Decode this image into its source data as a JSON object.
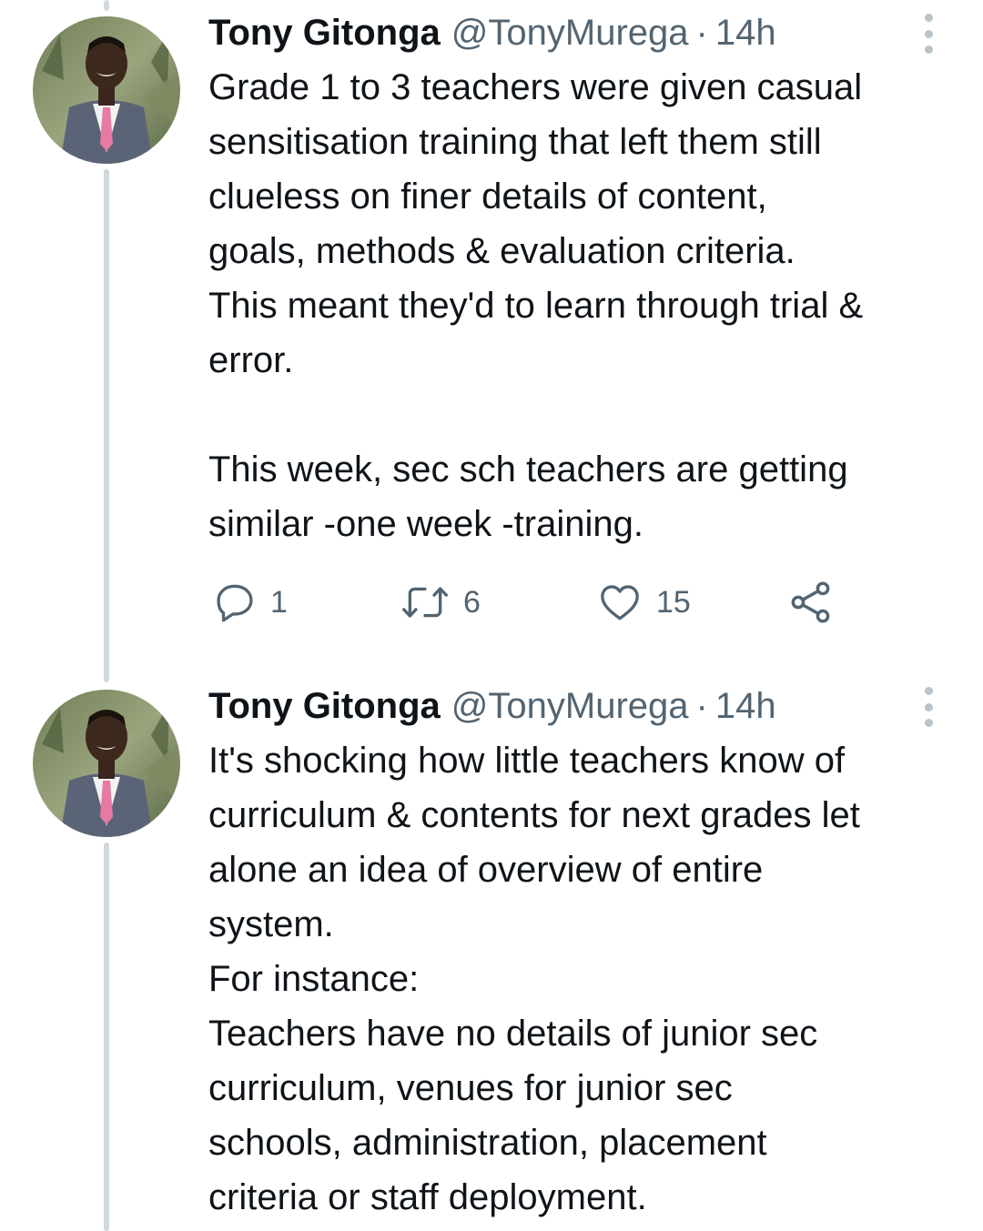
{
  "tweets": [
    {
      "author_name": "Tony Gitonga",
      "author_handle": "@TonyMurega",
      "separator": "·",
      "timestamp": "14h",
      "lines": [
        "Grade 1 to 3 teachers were given casual",
        "sensitisation training that left them still",
        "clueless on finer details of content,",
        "goals, methods & evaluation criteria.",
        "This meant they'd to learn through trial &",
        "error.",
        "",
        "This week, sec sch teachers are getting",
        "similar -one week -training."
      ],
      "replies": "1",
      "retweets": "6",
      "likes": "15",
      "icons": {
        "reply": "reply-icon",
        "retweet": "retweet-icon",
        "like": "heart-icon",
        "share": "share-icon",
        "more": "more-vertical-icon"
      }
    },
    {
      "author_name": "Tony Gitonga",
      "author_handle": "@TonyMurega",
      "separator": "·",
      "timestamp": "14h",
      "lines": [
        "It's shocking how little teachers know of",
        "curriculum & contents for next grades let",
        "alone an idea of overview of entire",
        "system.",
        "For instance:",
        "Teachers have no details of junior sec",
        "curriculum, venues for junior sec",
        "schools, administration, placement",
        "criteria or staff deployment."
      ]
    }
  ],
  "colors": {
    "text": "#0f1419",
    "secondary": "#536471",
    "thread_line": "#cfd9de",
    "icon": "#536471"
  }
}
